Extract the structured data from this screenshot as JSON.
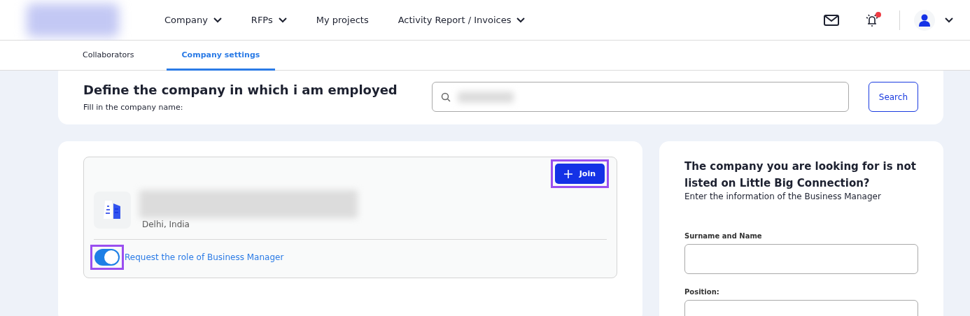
{
  "nav": {
    "items": [
      {
        "label": "Company",
        "dropdown": true
      },
      {
        "label": "RFPs",
        "dropdown": true
      },
      {
        "label": "My projects",
        "dropdown": false
      },
      {
        "label": "Activity Report / Invoices",
        "dropdown": true
      }
    ],
    "notification_unread": true
  },
  "tabs": [
    {
      "label": "Collaborators",
      "selected": false
    },
    {
      "label": "Company settings",
      "selected": true
    }
  ],
  "search_card": {
    "title": "Define the company in which i am employed",
    "subtitle": "Fill in the company name:",
    "button": "Search"
  },
  "result": {
    "location": "Delhi, India",
    "join_button": "Join",
    "highlighted": true,
    "toggle": {
      "label": "Request the role of Business Manager",
      "on": true,
      "highlighted": true
    }
  },
  "side_form": {
    "title": "The company you are looking for is not listed on Little Big Connection?",
    "subtitle": "Enter the information of the Business Manager",
    "fields": [
      {
        "label": "Surname and Name"
      },
      {
        "label": "Position:"
      }
    ]
  }
}
